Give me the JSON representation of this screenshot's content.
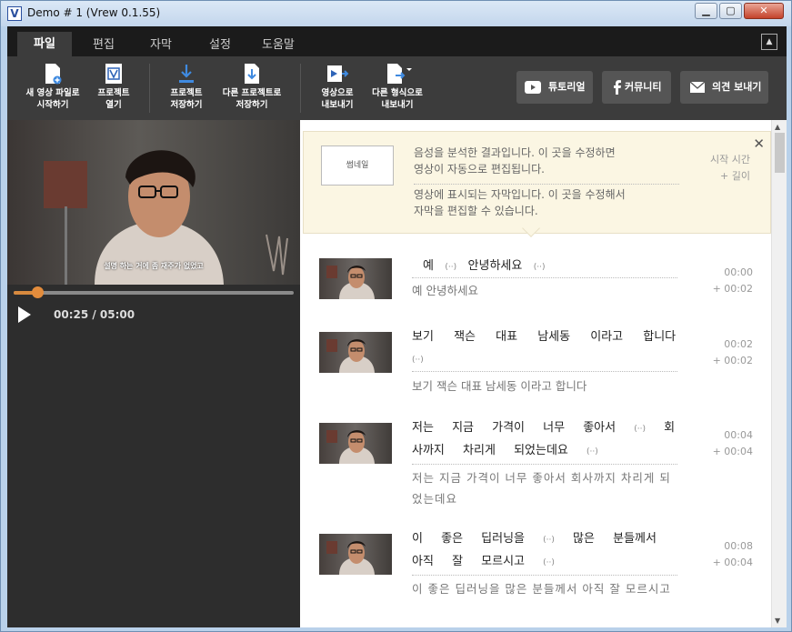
{
  "window": {
    "title": "Demo # 1 (Vrew 0.1.55)",
    "app_icon": "V",
    "minimize": "▁",
    "maximize": "▢",
    "close": "✕"
  },
  "menu": [
    "파일",
    "편집",
    "자막",
    "설정",
    "도움말"
  ],
  "toolbar": {
    "new": [
      "새 영상 파일로",
      "시작하기"
    ],
    "open": [
      "프로젝트",
      "열기"
    ],
    "save": [
      "프로젝트",
      "저장하기"
    ],
    "save_as": [
      "다른 프로젝트로",
      "저장하기"
    ],
    "export_video": [
      "영상으로",
      "내보내기"
    ],
    "export_format": [
      "다른 형식으로",
      "내보내기"
    ],
    "tutorial": "튜토리얼",
    "community": "커뮤니티",
    "feedback": "의견 보내기"
  },
  "player": {
    "subtitle": "설명 하는 거에 좀 재주가 없었고",
    "time": "00:25 / 05:00",
    "progress": 0.083
  },
  "guide": {
    "thumbnail": "썸네일",
    "line1": "음성을 분석한 결과입니다. 이 곳을 수정하면",
    "line1b": "영상이 자동으로 편집됩니다.",
    "line2": "영상에 표시되는 자막입니다. 이 곳을 수정해서",
    "line2b": "자막을 편집할 수 있습니다.",
    "meta1": "시작 시간",
    "meta2": "+ 길이",
    "close": "✕"
  },
  "clips": [
    {
      "words": [
        "예",
        "(··)",
        "안녕하세요",
        "(··)"
      ],
      "caption": "예 안녕하세요",
      "start": "00:00",
      "length": "+ 00:02"
    },
    {
      "words": [
        "보기",
        "잭슨",
        "대표",
        "남세동",
        "이라고",
        "합니다",
        "(··)"
      ],
      "caption": "보기 잭슨 대표 남세동 이라고 합니다",
      "start": "00:02",
      "length": "+ 00:02"
    },
    {
      "words": [
        "저는",
        "지금",
        "가격이",
        "너무",
        "좋아서",
        "(··)",
        "회사까지",
        "차리게",
        "되었는데요",
        "(··)"
      ],
      "caption": "저는 지금 가격이 너무 좋아서 회사까지 차리게 되었는데요",
      "start": "00:04",
      "length": "+ 00:04"
    },
    {
      "words": [
        "이",
        "좋은",
        "딥러닝을",
        "(··)",
        "많은",
        "분들께서",
        "아직",
        "잘",
        "모르시고",
        "(··)"
      ],
      "caption": "이 좋은 딥러닝을 많은 분들께서 아직 잘 모르시고",
      "start": "00:08",
      "length": "+ 00:04"
    }
  ]
}
